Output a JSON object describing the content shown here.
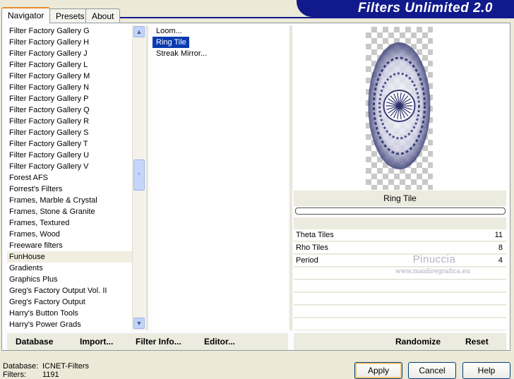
{
  "tabs": [
    "Navigator",
    "Presets",
    "About"
  ],
  "app_title": "Filters Unlimited 2.0",
  "categories": [
    "Filter Factory Gallery G",
    "Filter Factory Gallery H",
    "Filter Factory Gallery J",
    "Filter Factory Gallery L",
    "Filter Factory Gallery M",
    "Filter Factory Gallery N",
    "Filter Factory Gallery P",
    "Filter Factory Gallery Q",
    "Filter Factory Gallery R",
    "Filter Factory Gallery S",
    "Filter Factory Gallery T",
    "Filter Factory Gallery U",
    "Filter Factory Gallery V",
    "Forest AFS",
    "Forrest's Filters",
    "Frames, Marble & Crystal",
    "Frames, Stone & Granite",
    "Frames, Textured",
    "Frames, Wood",
    "Freeware filters",
    "FunHouse",
    "Gradients",
    "Graphics Plus",
    "Greg's Factory Output Vol. II",
    "Greg's Factory Output",
    "Harry's Button Tools",
    "Harry's Power Grads"
  ],
  "selected_category": "FunHouse",
  "filters": [
    "Loom...",
    "Ring Tile",
    "Streak Mirror..."
  ],
  "selected_filter": "Ring Tile",
  "preview_filter_name": "Ring Tile",
  "parameters": [
    {
      "label": "Theta Tiles",
      "value": "11"
    },
    {
      "label": "Rho Tiles",
      "value": "8"
    },
    {
      "label": "Period",
      "value": "4"
    }
  ],
  "watermark": {
    "name": "Pinuccia",
    "url": "www.maidiregrafica.eu"
  },
  "bottom_buttons": {
    "database": "Database",
    "import": "Import...",
    "filter_info": "Filter Info...",
    "editor": "Editor...",
    "randomize": "Randomize",
    "reset": "Reset"
  },
  "info": {
    "database_label": "Database:",
    "database_value": "ICNET-Filters",
    "filters_label": "Filters:",
    "filters_value": "1191"
  },
  "dialog_buttons": {
    "apply": "Apply",
    "cancel": "Cancel",
    "help": "Help"
  },
  "colors": {
    "banner": "#101a8c",
    "selection": "#0a3bb0",
    "tab_accent": "#e68b2c"
  },
  "icons": {
    "scroll_up": "scroll-up-icon",
    "scroll_down": "scroll-down-icon"
  }
}
